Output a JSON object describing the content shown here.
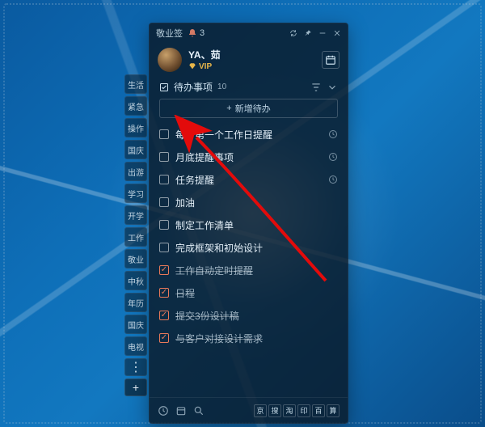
{
  "app_title": "敬业签",
  "notification_count": "3",
  "user": {
    "name": "YA、茹",
    "vip": "VIP"
  },
  "section": {
    "title": "待办事项",
    "count": "10"
  },
  "add_button": "新增待办",
  "tasks": [
    {
      "label": "每月第一个工作日提醒",
      "done": false,
      "has_time": true
    },
    {
      "label": "月底提醒事项",
      "done": false,
      "has_time": true
    },
    {
      "label": "任务提醒",
      "done": false,
      "has_time": true
    },
    {
      "label": "加油",
      "done": false,
      "has_time": false
    },
    {
      "label": "制定工作清单",
      "done": false,
      "has_time": false
    },
    {
      "label": "完成框架和初始设计",
      "done": false,
      "has_time": false
    },
    {
      "label": "工作自动定时提醒",
      "done": true,
      "has_time": false
    },
    {
      "label": "日程",
      "done": true,
      "has_time": false
    },
    {
      "label": "提交3份设计稿",
      "done": true,
      "has_time": false
    },
    {
      "label": "与客户对接设计需求",
      "done": true,
      "has_time": false
    }
  ],
  "sidebar_tags": [
    "生活",
    "紧急",
    "操作",
    "国庆",
    "出游",
    "学习",
    "开学",
    "工作",
    "敬业",
    "中秋",
    "年历",
    "国庆",
    "电视"
  ],
  "quick_links": [
    "京",
    "搜",
    "淘",
    "印",
    "百",
    "算"
  ]
}
